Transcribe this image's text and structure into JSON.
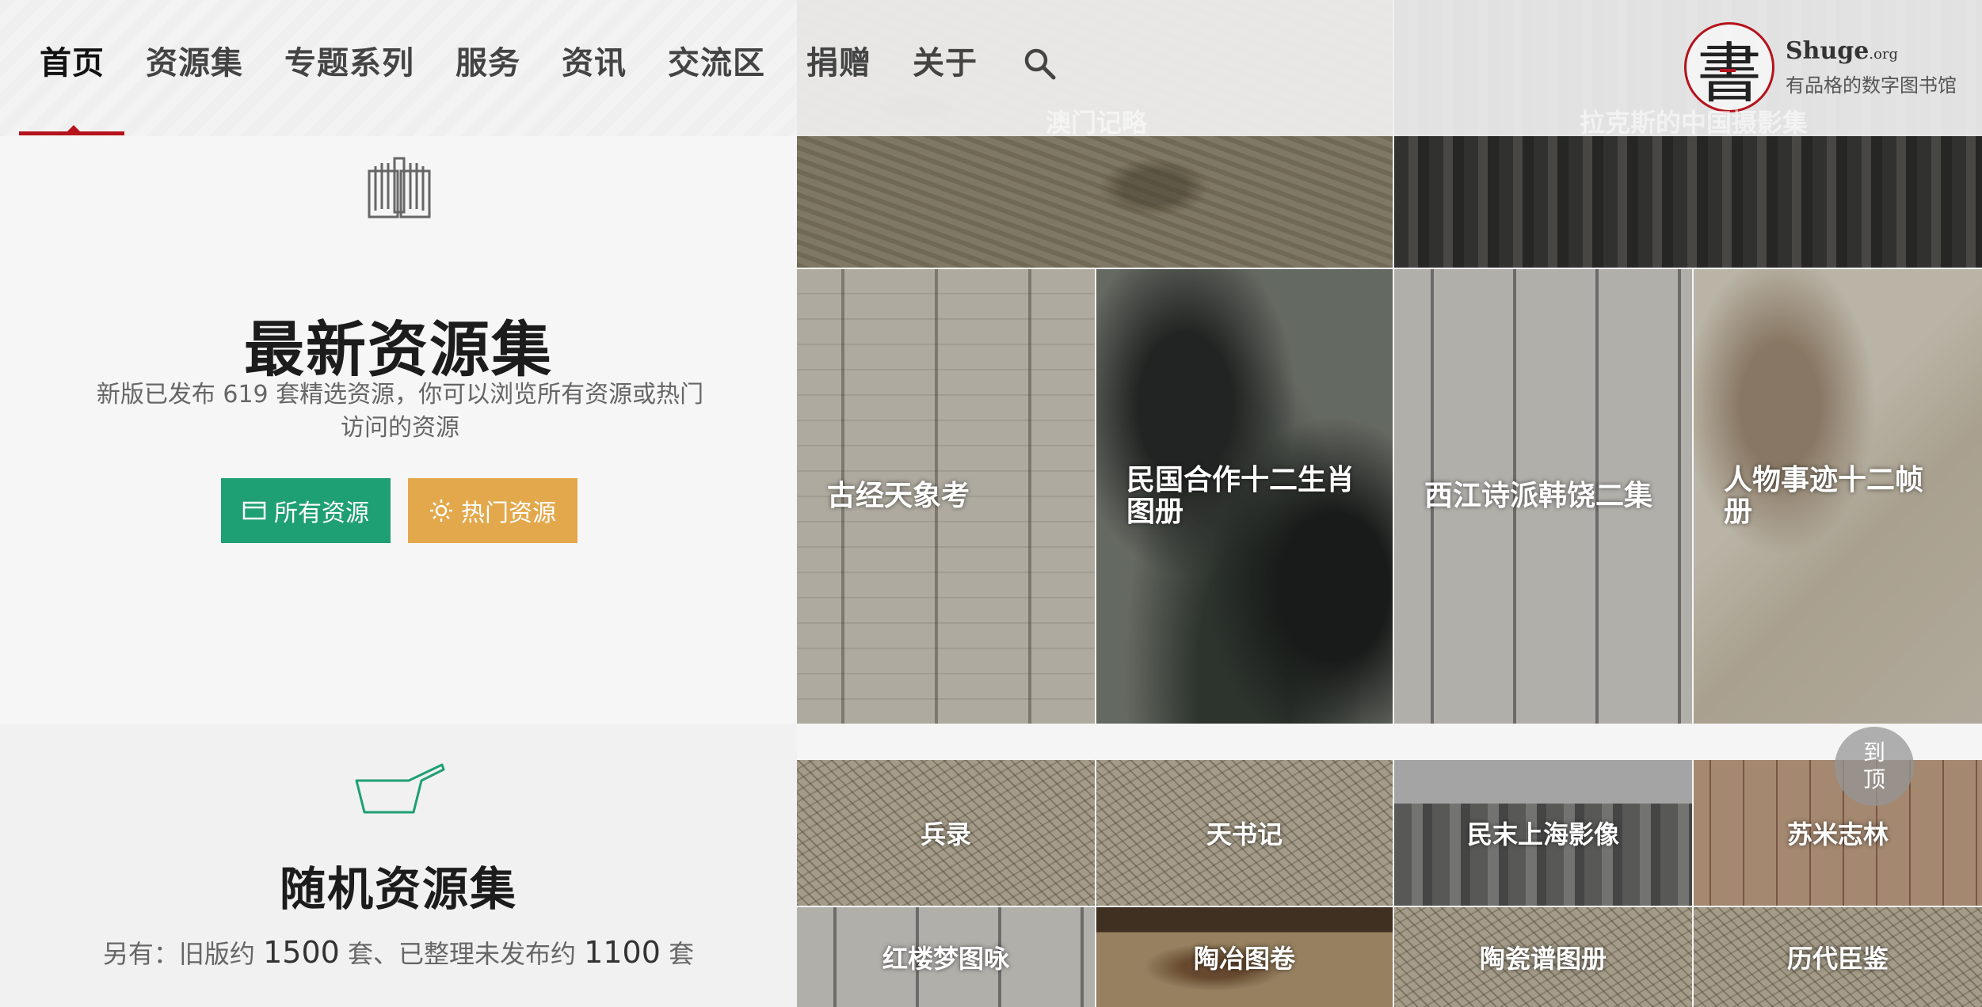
{
  "nav": {
    "items": [
      {
        "label": "首页"
      },
      {
        "label": "资源集"
      },
      {
        "label": "专题系列"
      },
      {
        "label": "服务"
      },
      {
        "label": "资讯"
      },
      {
        "label": "交流区"
      },
      {
        "label": "捐赠"
      },
      {
        "label": "关于"
      }
    ],
    "active_index": 0,
    "search_icon": "search-icon"
  },
  "logo": {
    "seal_char": "書",
    "name": "Shuge",
    "domain": ".org",
    "tagline": "有品格的数字图书馆"
  },
  "latest": {
    "icon": "open-book-icon",
    "title": "最新资源集",
    "description": "新版已发布 619 套精选资源，你可以浏览所有资源或热门访问的资源",
    "btn_all": "所有资源",
    "btn_hot": "热门资源"
  },
  "random": {
    "icon": "dustpan-icon",
    "title": "随机资源集",
    "desc_prefix": "另有：旧版约 ",
    "old_count": "1500",
    "desc_mid": " 套、已整理未发布约 ",
    "pending_count": "1100",
    "desc_suffix": " 套"
  },
  "ghost_tiles": [
    {
      "label": "澳门记略"
    },
    {
      "label": "拉克斯的中国摄影集"
    }
  ],
  "featured_tiles": [
    {
      "label": "古经天象考"
    },
    {
      "label": "民国合作十二生肖图册"
    },
    {
      "label": "西江诗派韩饶二集"
    },
    {
      "label": "人物事迹十二帧册"
    }
  ],
  "random_tiles": [
    {
      "label": "兵录"
    },
    {
      "label": "天书记"
    },
    {
      "label": "民末上海影像"
    },
    {
      "label": "苏米志林"
    },
    {
      "label": "红楼梦图咏"
    },
    {
      "label": "陶冶图卷"
    },
    {
      "label": "陶瓷谱图册"
    },
    {
      "label": "历代臣鉴"
    }
  ],
  "to_top": {
    "line1": "到",
    "line2": "顶"
  },
  "colors": {
    "accent_red": "#b5121b",
    "btn_green": "#1f9f74",
    "btn_orange": "#e3a84b"
  }
}
